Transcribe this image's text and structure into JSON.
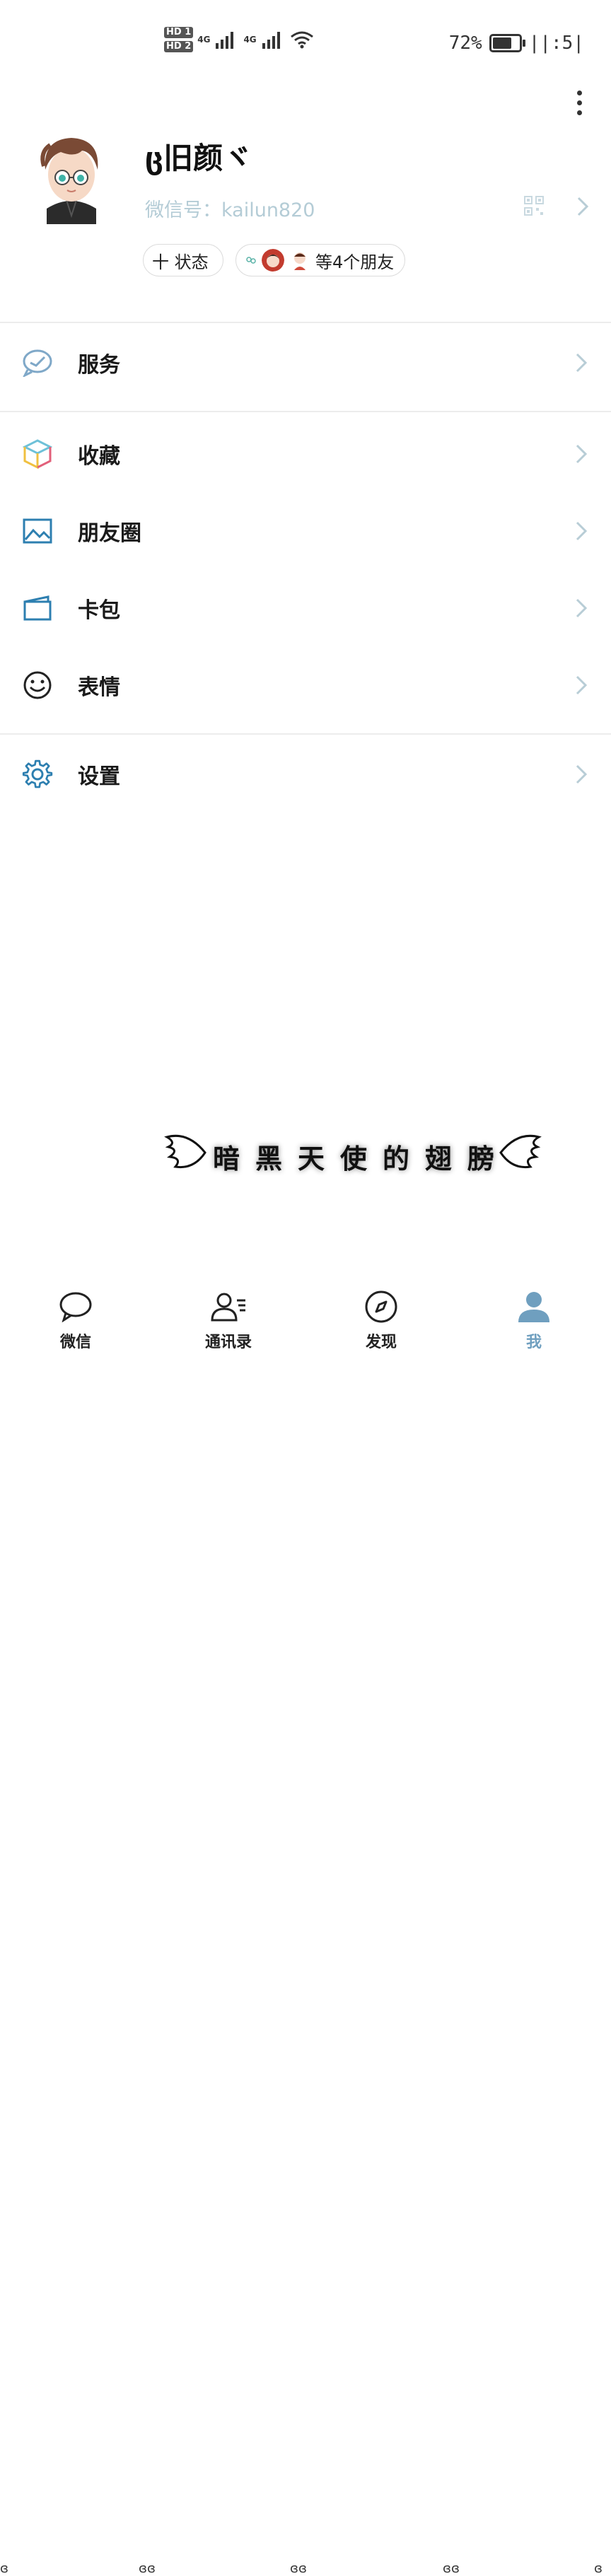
{
  "status_bar": {
    "hd1": "HD 1",
    "hd2": "HD 2",
    "net1": "4G",
    "net2": "4G",
    "battery_percent": "72%",
    "battery_level": 0.72,
    "time": "||:5|"
  },
  "profile": {
    "nickname": "ც旧颜ヾ",
    "wechat_id": "微信号：kailun820",
    "status_button": "十 状态",
    "friends_button": "等4个朋友"
  },
  "menu": {
    "service": "服务",
    "favorites": "收藏",
    "moments": "朋友圈",
    "cards": "卡包",
    "stickers": "表情",
    "settings": "设置"
  },
  "decoration": {
    "wing_text": [
      "暗",
      "黑",
      "天",
      "使",
      "的",
      "翅",
      "膀"
    ]
  },
  "nav": {
    "chats": "微信",
    "contacts": "通讯录",
    "discover": "发现",
    "me": "我"
  },
  "colors": {
    "accent": "#6f9fbf",
    "icon_blue": "#2d7fb0"
  }
}
